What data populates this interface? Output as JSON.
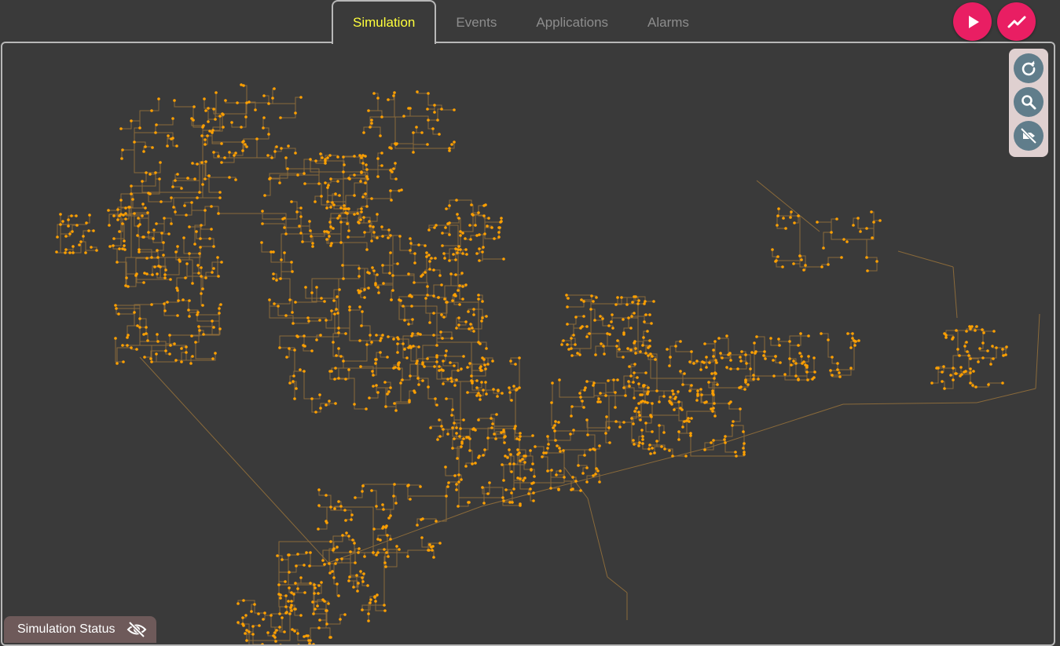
{
  "tabs": [
    {
      "label": "Simulation",
      "active": true
    },
    {
      "label": "Events",
      "active": false
    },
    {
      "label": "Applications",
      "active": false
    },
    {
      "label": "Alarms",
      "active": false
    }
  ],
  "actions": {
    "play_icon": "play-icon",
    "chart_icon": "trend-chart-icon"
  },
  "tools": {
    "refresh_icon": "refresh-icon",
    "search_icon": "search-icon",
    "hide_labels_icon": "label-off-icon"
  },
  "status": {
    "label": "Simulation Status",
    "icon": "eye-off-icon"
  },
  "colors": {
    "accent": "#e91e63",
    "active_tab": "#ffff3b",
    "node": "#ffa000",
    "line": "#8a6a3a",
    "tool_bg": "#607d8b",
    "toolbox_bg": "#dfd0d0",
    "status_bg": "#6e5a5a"
  }
}
